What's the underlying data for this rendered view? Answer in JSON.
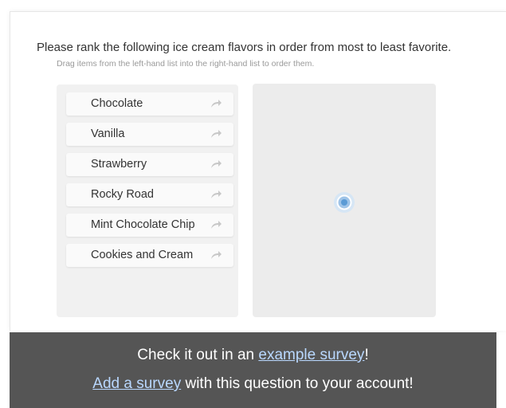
{
  "question": {
    "title": "Please rank the following ice cream flavors in order from most to least favorite.",
    "instructions": "Drag items from the left-hand list into the right-hand list to order them."
  },
  "ranking": {
    "items": [
      {
        "label": "Chocolate"
      },
      {
        "label": "Vanilla"
      },
      {
        "label": "Strawberry"
      },
      {
        "label": "Rocky Road"
      },
      {
        "label": "Mint Chocolate Chip"
      },
      {
        "label": "Cookies and Cream"
      }
    ],
    "item_icon": "arrow-right-icon",
    "drop_target_icon": "cursor-target-icon"
  },
  "banner": {
    "line1_prefix": "Check it out in an ",
    "line1_link": "example survey",
    "line1_suffix": "!",
    "line2_link": "Add a survey",
    "line2_suffix": " with this question to your account!"
  },
  "colors": {
    "banner_bg": "#555555",
    "link": "#b9d8ff",
    "list_bg": "#f1f1f1",
    "drop_bg": "#ececec",
    "target_blue": "#5b9bd5"
  }
}
